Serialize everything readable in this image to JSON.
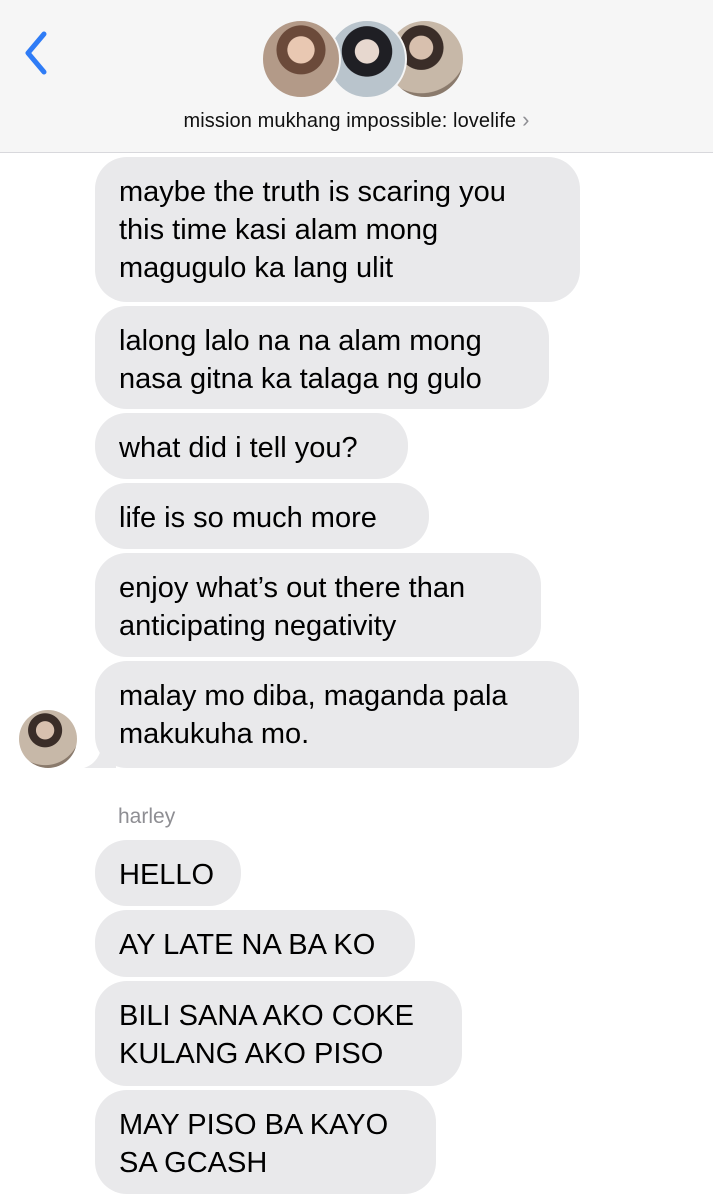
{
  "header": {
    "back_icon": "chevron-left-icon",
    "group_name": "mission mukhang impossible: lovelife",
    "chevron": "›",
    "accent_color": "#2f7cf6"
  },
  "messages": {
    "block1": [
      "maybe the truth is scaring you\nthis time kasi alam mong\nmagugulo ka lang ulit",
      "lalong lalo na na alam mong\nnasa gitna ka talaga ng gulo",
      "what did i tell you?",
      "life is so much more",
      "enjoy what’s out there than\nanticipating negativity",
      "malay mo diba, maganda pala\nmakukuha mo."
    ],
    "sender2_name": "harley",
    "block2": [
      "HELLO",
      "AY LATE NA BA KO",
      "BILI SANA AKO COKE\nKULANG AKO PISO",
      "MAY PISO BA KAYO\nSA GCASH"
    ]
  }
}
